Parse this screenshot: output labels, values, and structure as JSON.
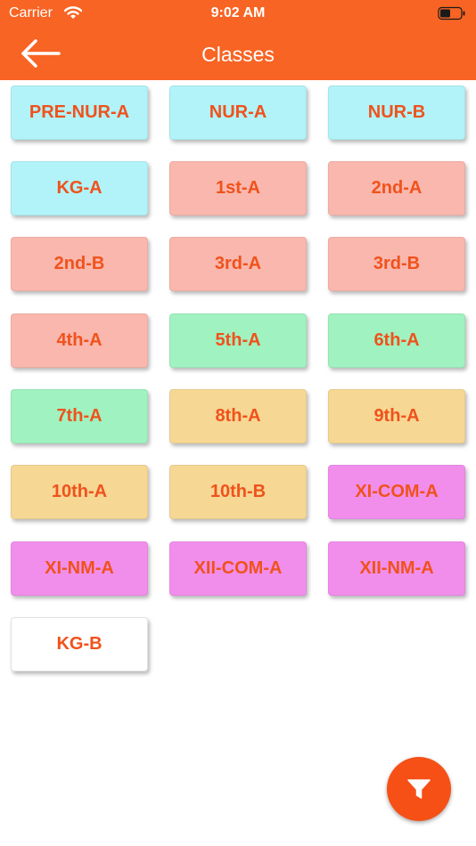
{
  "status_bar": {
    "carrier": "Carrier",
    "time": "9:02 AM"
  },
  "nav": {
    "title": "Classes",
    "back_icon": "arrow-left-icon"
  },
  "classes": [
    {
      "label": "PRE-NUR-A"
    },
    {
      "label": "NUR-A"
    },
    {
      "label": "NUR-B"
    },
    {
      "label": "KG-A"
    },
    {
      "label": "1st-A"
    },
    {
      "label": "2nd-A"
    },
    {
      "label": "2nd-B"
    },
    {
      "label": "3rd-A"
    },
    {
      "label": "3rd-B"
    },
    {
      "label": "4th-A"
    },
    {
      "label": "5th-A"
    },
    {
      "label": "6th-A"
    },
    {
      "label": "7th-A"
    },
    {
      "label": "8th-A"
    },
    {
      "label": "9th-A"
    },
    {
      "label": "10th-A"
    },
    {
      "label": "10th-B"
    },
    {
      "label": "XI-COM-A"
    },
    {
      "label": "XI-NM-A"
    },
    {
      "label": "XII-COM-A"
    },
    {
      "label": "XII-NM-A"
    },
    {
      "label": "KG-B"
    }
  ],
  "colors": {
    "accent": "#f86424",
    "label_text": "#f0521c",
    "cyan": "#b1f3f8",
    "salmon": "#f9b7ad",
    "mint": "#a0f2c0",
    "peach": "#f6d794",
    "pink": "#f18eec",
    "white": "#ffffff"
  },
  "filter": {
    "icon": "filter-icon"
  }
}
